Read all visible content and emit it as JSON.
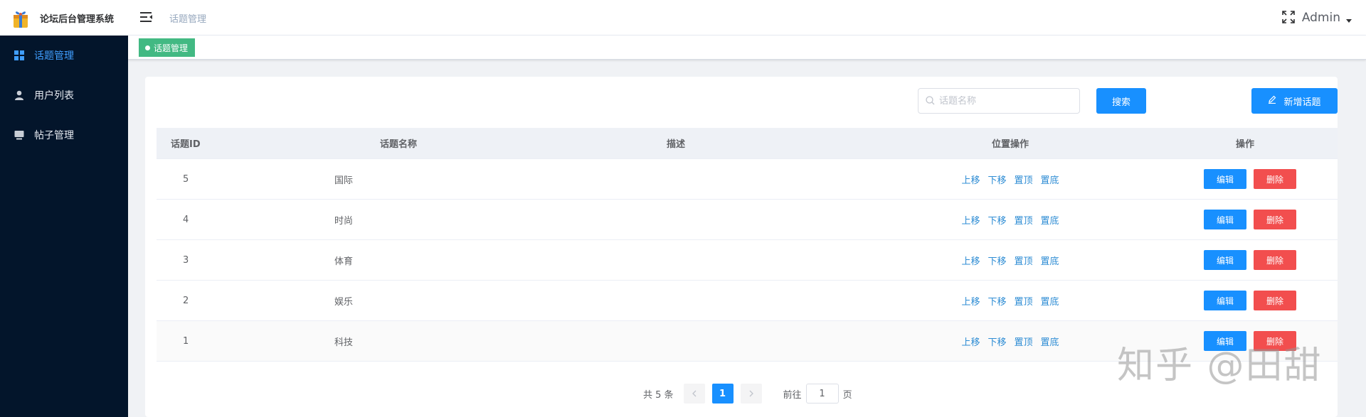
{
  "app": {
    "title": "论坛后台管理系统",
    "logo_icon": "gift-bag-logo-icon"
  },
  "sidebar": {
    "items": [
      {
        "label": "话题管理",
        "icon": "dashboard-grid-icon",
        "active": true
      },
      {
        "label": "用户列表",
        "icon": "user-icon",
        "active": false
      },
      {
        "label": "帖子管理",
        "icon": "monitor-icon",
        "active": false
      }
    ]
  },
  "header": {
    "breadcrumb": "话题管理",
    "user": "Admin",
    "fullscreen_icon": "fullscreen-icon",
    "menu_toggle_icon": "menu-fold-icon"
  },
  "tags": [
    {
      "label": "话题管理",
      "active": true
    }
  ],
  "toolbar": {
    "search_placeholder": "话题名称",
    "search_value": "",
    "search_button": "搜索",
    "add_button": "新增话题"
  },
  "table": {
    "columns": [
      "话题ID",
      "话题名称",
      "描述",
      "位置操作",
      "操作"
    ],
    "rows": [
      {
        "id": "5",
        "name": "国际",
        "desc": ""
      },
      {
        "id": "4",
        "name": "时尚",
        "desc": ""
      },
      {
        "id": "3",
        "name": "体育",
        "desc": ""
      },
      {
        "id": "2",
        "name": "娱乐",
        "desc": ""
      },
      {
        "id": "1",
        "name": "科技",
        "desc": ""
      }
    ],
    "position_actions": [
      "上移",
      "下移",
      "置顶",
      "置底"
    ],
    "row_actions": {
      "edit": "编辑",
      "delete": "删除"
    }
  },
  "pagination": {
    "total_text": "共 5 条",
    "current_page": "1",
    "goto_label": "前往",
    "goto_value": "1",
    "page_suffix": "页"
  },
  "watermark": "知乎 @田甜",
  "colors": {
    "primary": "#1890ff",
    "danger": "#f24e4e",
    "sidebar_bg": "#03152b",
    "tag_green": "#42b983",
    "link": "#2d8cd4"
  }
}
